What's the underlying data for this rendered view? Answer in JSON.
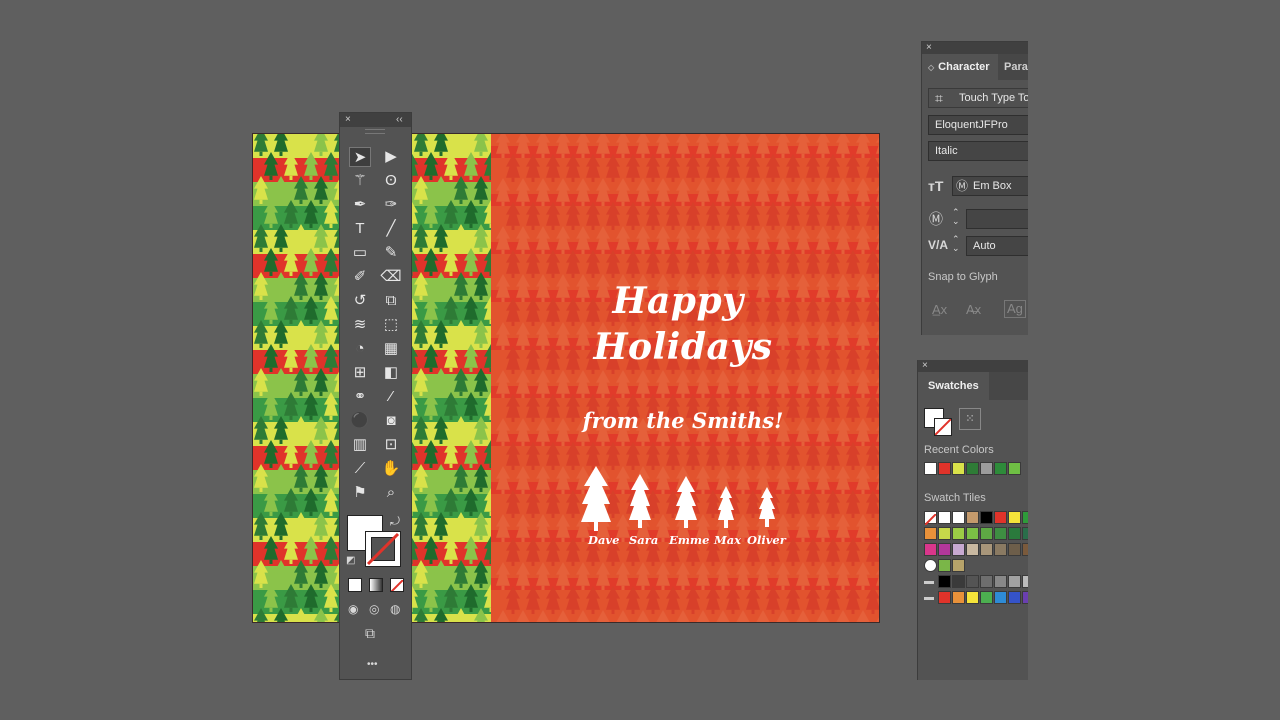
{
  "card": {
    "title_line1": "Happy",
    "title_line2": "Holidays",
    "subtitle": "from the Smiths!",
    "names": [
      "Dave",
      "Sara",
      "Emme",
      "Max",
      "Oliver"
    ],
    "colors": {
      "orange": "#e2532e",
      "red": "#e0332a",
      "dark_green": "#2e7b36",
      "light_green": "#8bc34a",
      "yellow": "#d9e24a",
      "white": "#ffffff"
    }
  },
  "tools_panel": {
    "close_glyph": "×",
    "collapse_glyph": "‹‹",
    "more_glyph": "•••",
    "tools": [
      {
        "name": "selection-tool-icon",
        "glyph": "➤"
      },
      {
        "name": "direct-selection-tool-icon",
        "glyph": "▶"
      },
      {
        "name": "magic-wand-tool-icon",
        "glyph": "⚚"
      },
      {
        "name": "lasso-tool-icon",
        "glyph": "ʘ"
      },
      {
        "name": "pen-tool-icon",
        "glyph": "✒"
      },
      {
        "name": "curvature-tool-icon",
        "glyph": "✑"
      },
      {
        "name": "type-tool-icon",
        "glyph": "T"
      },
      {
        "name": "line-tool-icon",
        "glyph": "╱"
      },
      {
        "name": "rectangle-tool-icon",
        "glyph": "▭"
      },
      {
        "name": "paintbrush-tool-icon",
        "glyph": "✎"
      },
      {
        "name": "shaper-tool-icon",
        "glyph": "✐"
      },
      {
        "name": "eraser-tool-icon",
        "glyph": "⌫"
      },
      {
        "name": "rotate-tool-icon",
        "glyph": "↺"
      },
      {
        "name": "scale-tool-icon",
        "glyph": "⧉"
      },
      {
        "name": "width-tool-icon",
        "glyph": "≋"
      },
      {
        "name": "free-transform-tool-icon",
        "glyph": "⬚"
      },
      {
        "name": "shape-builder-tool-icon",
        "glyph": "◔"
      },
      {
        "name": "perspective-grid-tool-icon",
        "glyph": "▦"
      },
      {
        "name": "mesh-tool-icon",
        "glyph": "⊞"
      },
      {
        "name": "gradient-tool-icon",
        "glyph": "◧"
      },
      {
        "name": "blend-tool-icon",
        "glyph": "⚭"
      },
      {
        "name": "eyedropper-tool-icon",
        "glyph": "⁄"
      },
      {
        "name": "symbol-sprayer-tool-icon",
        "glyph": "⚫"
      },
      {
        "name": "live-paint-tool-icon",
        "glyph": "◙"
      },
      {
        "name": "column-graph-tool-icon",
        "glyph": "▥"
      },
      {
        "name": "artboard-tool-icon",
        "glyph": "⊡"
      },
      {
        "name": "slice-tool-icon",
        "glyph": "⟋"
      },
      {
        "name": "hand-tool-icon",
        "glyph": "✋"
      },
      {
        "name": "puppet-warp-tool-icon",
        "glyph": "⚑"
      },
      {
        "name": "zoom-tool-icon",
        "glyph": "⌕"
      }
    ]
  },
  "character_panel": {
    "close_glyph": "×",
    "tab_character": "Character",
    "tab_paragraph": "Parag",
    "touch_type_label": "Touch Type To",
    "font_family": "EloquentJFPro",
    "font_style": "Italic",
    "em_box": "Em Box",
    "kerning_value": "",
    "tracking_value": "Auto",
    "snap_to_glyph": "Snap to Glyph"
  },
  "swatches_panel": {
    "close_glyph": "×",
    "tab_label": "Swatches",
    "recent_colors_label": "Recent Colors",
    "swatch_tiles_label": "Swatch Tiles",
    "recent_colors": [
      "#ffffff",
      "#e0332a",
      "#d9e24a",
      "#2e7b36",
      "#9c9c9c",
      "#2e8b3a",
      "#6fbf44"
    ],
    "tile_rows": [
      [
        "none",
        "#ffffff",
        "#ffffff",
        "#c49a6c",
        "#000000",
        "#e0332a",
        "#f5e43a",
        "#2e9b3a"
      ],
      [
        "#e8913a",
        "#c7d84a",
        "#9ccc45",
        "#7bbf45",
        "#5ea944",
        "#3e8e42",
        "#2a7a3c",
        "#2a6e4a"
      ],
      [
        "#d9368b",
        "#b2379a",
        "#c7a9d0",
        "#c8b8a0",
        "#a8967a",
        "#8a7a62",
        "#6d5e4a",
        "#7a5a3c"
      ],
      [
        "pattern",
        "#7ab648",
        "#b7a36a"
      ],
      [
        "folder",
        "#000000",
        "#3a3a3a",
        "#545454",
        "#6e6e6e",
        "#888888",
        "#a2a2a2",
        "#bcbcbc"
      ],
      [
        "folder",
        "#e0332a",
        "#e8913a",
        "#f5e43a",
        "#4caf50",
        "#2e8bd6",
        "#3553c8",
        "#6a3fb0"
      ]
    ]
  }
}
